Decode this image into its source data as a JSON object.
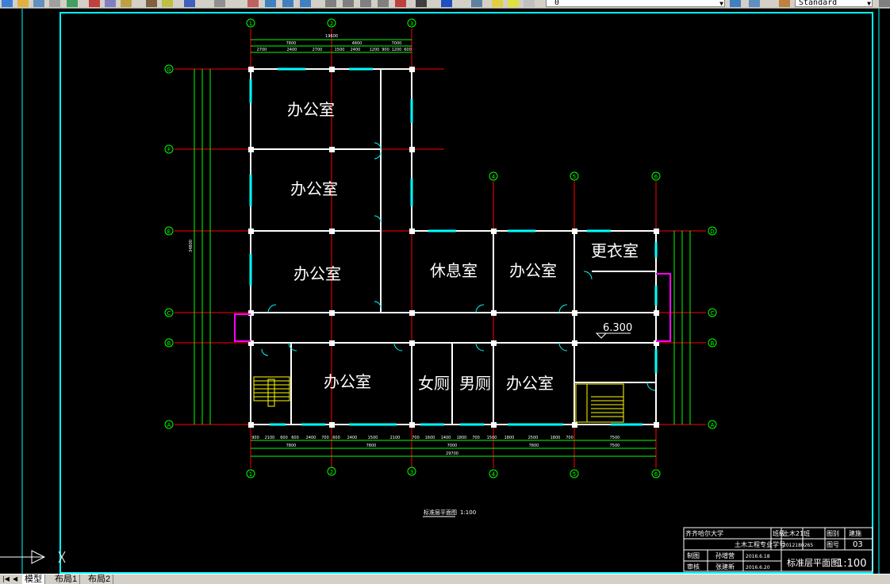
{
  "toolbar": {
    "layer_value": "0",
    "text_style_value": "Standard"
  },
  "drawing": {
    "grid_cols": [
      "1",
      "2",
      "3",
      "4",
      "5",
      "6"
    ],
    "grid_rows": [
      "G",
      "F",
      "E",
      "D",
      "C",
      "B",
      "A"
    ],
    "rooms": [
      {
        "id": "office1",
        "label": "办公室"
      },
      {
        "id": "office2",
        "label": "办公室"
      },
      {
        "id": "office3",
        "label": "办公室"
      },
      {
        "id": "lounge",
        "label": "休息室"
      },
      {
        "id": "office4",
        "label": "办公室"
      },
      {
        "id": "changing",
        "label": "更衣室"
      },
      {
        "id": "office5",
        "label": "办公室"
      },
      {
        "id": "women",
        "label": "女厕"
      },
      {
        "id": "men",
        "label": "男厕"
      },
      {
        "id": "office6",
        "label": "办公室"
      }
    ],
    "elevation_label": "6.300",
    "plan_caption": "标准层平面图",
    "plan_scale": "1:100",
    "top_total_dim": "19600",
    "top_dims": [
      "7800",
      "4800",
      "7000"
    ],
    "top_sub_dims": [
      "2700",
      "2400",
      "2700",
      "1500",
      "2400",
      "1200",
      "900",
      "1200",
      "600"
    ],
    "bottom_sub_dims": [
      "900",
      "2100",
      "600",
      "600",
      "2400",
      "700",
      "600",
      "2400",
      "1500",
      "2100",
      "700",
      "1600",
      "1400",
      "1800",
      "700",
      "1500",
      "1800",
      "2500",
      "1800",
      "700",
      "7500"
    ],
    "bottom_dims": [
      "7800",
      "7800",
      "7000",
      "7800",
      "7500"
    ],
    "bottom_total_dim": "29700",
    "left_total_dim": "34800"
  },
  "title_block": {
    "school": "齐齐哈尔大学",
    "class_label": "班级",
    "class_value": "土木21班",
    "drawing_label": "图别",
    "drawing_value": "建施",
    "major": "土木工程专业",
    "id_label": "学号",
    "id_value": "2012180265",
    "sheet_label": "图号",
    "sheet_value": "03",
    "draw_label": "制图",
    "draw_name": "孙增营",
    "draw_date": "2016.6.18",
    "review_label": "审核",
    "review_name": "张建新",
    "review_date": "2016.6.20",
    "title": "标准层平面图",
    "scale": "1:100"
  },
  "layout_tabs": [
    "模型",
    "布局1",
    "布局2"
  ],
  "colors": {
    "background": "#000000",
    "border": "#00ffff",
    "grid_line": "#ff0000",
    "wall": "#ffffff",
    "window": "#00ffff",
    "dimension": "#00ff00",
    "stair": "#ffff00",
    "magenta": "#ff00ff"
  }
}
